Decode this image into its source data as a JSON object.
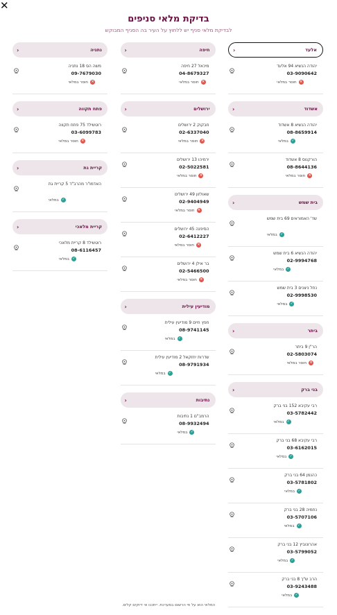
{
  "header": {
    "close_label": "✕",
    "title": "בדיקת מלאי סניפים",
    "subtitle": "לבדיקת מלאי סניף יש ללחוץ על העיר בה הסניף המבוקש"
  },
  "colors": {
    "accent": "#6a1244",
    "ok": "#2aa198",
    "no": "#e0544a",
    "header_bg": "#ede5e9"
  },
  "columns": [
    [
      {
        "city": "אלעד",
        "active": true,
        "branches": [
          {
            "addr": "יהודה הנשיא 94 אלעד",
            "phone": "03-9090642",
            "status": "חוסר במלאי",
            "ok": false
          }
        ]
      },
      {
        "city": "אשדוד",
        "branches": [
          {
            "addr": "יהודה הנשיא 8 אשדוד",
            "phone": "08-8659914",
            "status": "במלאי",
            "ok": true
          },
          {
            "addr": "הורקנוס 8 אשדוד",
            "phone": "08-8644136",
            "status": "חוסר במלאי",
            "ok": false
          }
        ]
      },
      {
        "city": "בית שמש",
        "branches": [
          {
            "addr": "שד' האמוראים 69 בית שמש",
            "phone": "",
            "status": "במלאי",
            "ok": true
          },
          {
            "addr": "יהודה הנשיא 6 בית שמש",
            "phone": "02-9994768",
            "status": "במלאי",
            "ok": true
          },
          {
            "addr": "נחל ניצנים 3 בית שמש",
            "phone": "02-9998530",
            "status": "במלאי",
            "ok": true
          }
        ]
      },
      {
        "city": "ביתר",
        "branches": [
          {
            "addr": "הר\"ן 9 ביתר",
            "phone": "02-5803074",
            "status": "חוסר במלאי",
            "ok": false
          }
        ]
      },
      {
        "city": "בני ברק",
        "branches": [
          {
            "addr": "רבי עקיבא 152 בני ברק",
            "phone": "03-5782442",
            "status": "במלאי",
            "ok": true
          },
          {
            "addr": "רבי עקיבא 68 בני ברק",
            "phone": "03-6162015",
            "status": "במלאי",
            "ok": true
          },
          {
            "addr": "כהנמן 64 בני ברק",
            "phone": "03-5781802",
            "status": "במלאי",
            "ok": true
          },
          {
            "addr": "נחמיה 28 בני ברק",
            "phone": "03-5707106",
            "status": "במלאי",
            "ok": true
          },
          {
            "addr": "אהרונוביץ 12 בני ברק",
            "phone": "03-5799052",
            "status": "במלאי",
            "ok": true
          },
          {
            "addr": "הרב ש\"ך 8 בני ברק",
            "phone": "03-9243488",
            "status": "במלאי",
            "ok": true
          }
        ]
      }
    ],
    [
      {
        "city": "חיפה",
        "branches": [
          {
            "addr": "מיכאל 27 חיפה",
            "phone": "04-8679327",
            "status": "חוסר במלאי",
            "ok": false
          }
        ]
      },
      {
        "city": "ירושלים",
        "branches": [
          {
            "addr": "חבקוק 2 ירושלים",
            "phone": "02-6337040",
            "status": "חוסר במלאי",
            "ok": false
          },
          {
            "addr": "ירמיהו 13 ירושלים",
            "phone": "02-5022581",
            "status": "חוסר במלאי",
            "ok": false
          },
          {
            "addr": "שאולזון 49 ירושלים",
            "phone": "02-9404949",
            "status": "חוסר במלאי",
            "ok": false
          },
          {
            "addr": "הסיפנה 45 ירושלים",
            "phone": "02-6412227",
            "status": "חוסר במלאי",
            "ok": false
          },
          {
            "addr": "בר אילן 4 ירושלים",
            "phone": "02-5466500",
            "status": "חוסר במלאי",
            "ok": false
          }
        ]
      },
      {
        "city": "מודיעין עילית",
        "branches": [
          {
            "addr": "חפץ חיים 9 מודיעין עילית",
            "phone": "08-9741145",
            "status": "במלאי",
            "ok": true
          },
          {
            "addr": "שדרות יחזקאל 2 מודיעין עילית",
            "phone": "08-9791934",
            "status": "במלאי",
            "ok": true
          }
        ]
      },
      {
        "city": "נתיבות",
        "branches": [
          {
            "addr": "הרמב\"ם 1 נתיבות",
            "phone": "08-9932494",
            "status": "במלאי",
            "ok": true
          }
        ]
      }
    ],
    [
      {
        "city": "נתניה",
        "branches": [
          {
            "addr": "משה הס 18 נתניה",
            "phone": "09-7679030",
            "status": "חוסר במלאי",
            "ok": false
          }
        ]
      },
      {
        "city": "פתח תקווה",
        "branches": [
          {
            "addr": "רוטשילד 75 פתח תקווה",
            "phone": "03-6099783",
            "status": "חוסר במלאי",
            "ok": false
          }
        ]
      },
      {
        "city": "קריית גת",
        "branches": [
          {
            "addr": "האדמו\"ר מהרב\"ד 5 קריית גת",
            "phone": "",
            "status": "במלאי",
            "ok": true
          }
        ]
      },
      {
        "city": "קריית מלאכי",
        "branches": [
          {
            "addr": "רוטשילד 8 קריית מלאכי",
            "phone": "08-6116457",
            "status": "במלאי",
            "ok": true
          }
        ]
      }
    ]
  ],
  "footer": {
    "note": "המלאי הוא על פי הרשום במערכת. ייתכנו אי דיוקים קלים."
  }
}
